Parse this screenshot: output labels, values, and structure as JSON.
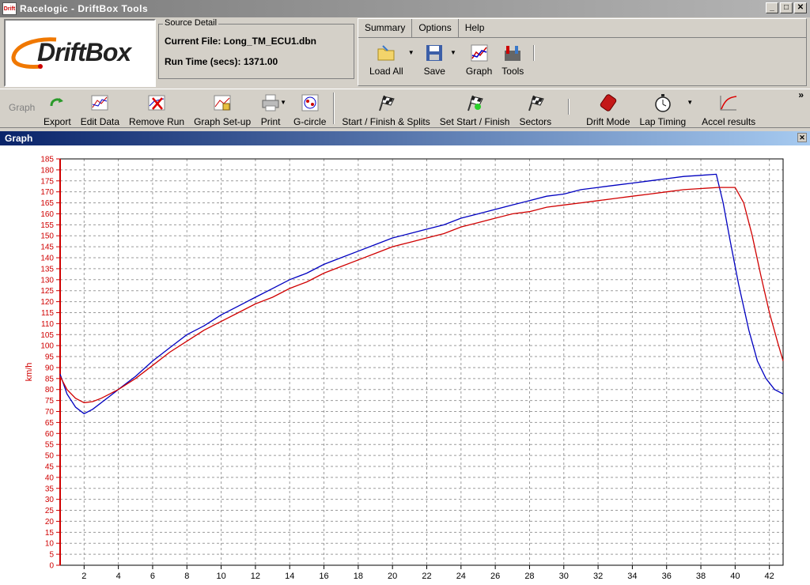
{
  "window": {
    "title": "Racelogic - DriftBox Tools",
    "icon_label": "Drift",
    "min_glyph": "_",
    "max_glyph": "□",
    "close_glyph": "✕"
  },
  "logo": {
    "text": "DriftBox"
  },
  "source_detail": {
    "legend": "Source Detail",
    "current_file_label": "Current File:",
    "current_file_value": "Long_TM_ECU1.dbn",
    "run_time_label": "Run Time (secs):",
    "run_time_value": "1371.00"
  },
  "menu": {
    "tabs": [
      "Summary",
      "Options",
      "Help"
    ]
  },
  "top_tools": {
    "load_all": "Load All",
    "save": "Save",
    "graph": "Graph",
    "tools": "Tools"
  },
  "toolbar": {
    "graph_label": "Graph",
    "export": "Export",
    "edit_data": "Edit Data",
    "remove_run": "Remove Run",
    "graph_setup": "Graph Set-up",
    "print": "Print",
    "g_circle": "G-circle",
    "start_finish_splits": "Start / Finish & Splits",
    "set_start_finish": "Set Start / Finish",
    "sectors": "Sectors",
    "drift_mode": "Drift Mode",
    "lap_timing": "Lap Timing",
    "accel_results": "Accel results",
    "more_glyph": "»"
  },
  "graph_window": {
    "title": "Graph",
    "close_glyph": "✕"
  },
  "chart_data": {
    "type": "line",
    "ylabel": "km/h",
    "xlabel": "",
    "xlim": [
      0.6,
      42.8
    ],
    "ylim": [
      0,
      185
    ],
    "x_ticks": [
      2,
      4,
      6,
      8,
      10,
      12,
      14,
      16,
      18,
      20,
      22,
      24,
      26,
      28,
      30,
      32,
      34,
      36,
      38,
      40,
      42
    ],
    "y_ticks": [
      0,
      5,
      10,
      15,
      20,
      25,
      30,
      35,
      40,
      45,
      50,
      55,
      60,
      65,
      70,
      75,
      80,
      85,
      90,
      95,
      100,
      105,
      110,
      115,
      120,
      125,
      130,
      135,
      140,
      145,
      150,
      155,
      160,
      165,
      170,
      175,
      180,
      185
    ],
    "grid": true,
    "colors": {
      "blue": "#0000c0",
      "red": "#d00000",
      "axis": "#d00000"
    },
    "series": [
      {
        "color": "#0000c0",
        "x": [
          0.6,
          1.0,
          1.5,
          2.0,
          2.5,
          3.0,
          3.5,
          4.0,
          5.0,
          6.0,
          7.0,
          8.0,
          9.0,
          10.0,
          11.0,
          12.0,
          13.0,
          14.0,
          15.0,
          16.0,
          17.0,
          18.0,
          19.0,
          20.0,
          21.0,
          22.0,
          23.0,
          24.0,
          25.0,
          26.0,
          27.0,
          28.0,
          29.0,
          30.0,
          31.0,
          32.0,
          33.0,
          34.0,
          35.0,
          36.0,
          37.0,
          38.0,
          38.9,
          39.3,
          39.7,
          40.2,
          40.8,
          41.3,
          41.8,
          42.3,
          42.8
        ],
        "y": [
          87,
          78,
          72,
          69,
          71,
          74,
          77,
          80,
          86,
          93,
          99,
          105,
          109,
          114,
          118,
          122,
          126,
          130,
          133,
          137,
          140,
          143,
          146,
          149,
          151,
          153,
          155,
          158,
          160,
          162,
          164,
          166,
          168,
          169,
          171,
          172,
          173,
          174,
          175,
          176,
          177,
          177.5,
          178,
          165,
          148,
          128,
          107,
          93,
          85,
          80,
          78
        ]
      },
      {
        "color": "#d00000",
        "x": [
          0.6,
          1.0,
          1.5,
          2.0,
          2.5,
          3.0,
          3.5,
          4.0,
          5.0,
          6.0,
          7.0,
          8.0,
          9.0,
          10.0,
          11.0,
          12.0,
          13.0,
          14.0,
          15.0,
          16.0,
          17.0,
          18.0,
          19.0,
          20.0,
          21.0,
          22.0,
          23.0,
          24.0,
          25.0,
          26.0,
          27.0,
          28.0,
          29.0,
          30.0,
          31.0,
          32.0,
          33.0,
          34.0,
          35.0,
          36.0,
          37.0,
          38.0,
          39.0,
          40.0,
          40.5,
          41.0,
          41.5,
          42.0,
          42.5,
          42.8
        ],
        "y": [
          86,
          80,
          76,
          74,
          74.5,
          76,
          78,
          80,
          85,
          91,
          97,
          102,
          107,
          111,
          115,
          119,
          122,
          126,
          129,
          133,
          136,
          139,
          142,
          145,
          147,
          149,
          151,
          154,
          156,
          158,
          160,
          161,
          163,
          164,
          165,
          166,
          167,
          168,
          169,
          170,
          171,
          171.5,
          172,
          172,
          165,
          150,
          132,
          115,
          101,
          93
        ]
      }
    ]
  }
}
